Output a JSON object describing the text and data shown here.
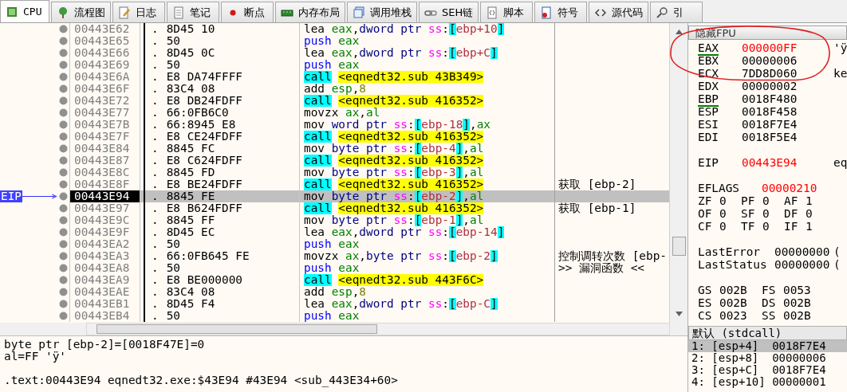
{
  "tabs": [
    {
      "label": "CPU",
      "selected": true
    },
    {
      "label": "流程图",
      "selected": false
    },
    {
      "label": "日志",
      "selected": false
    },
    {
      "label": "笔记",
      "selected": false
    },
    {
      "label": "断点",
      "selected": false
    },
    {
      "label": "内存布局",
      "selected": false
    },
    {
      "label": "调用堆栈",
      "selected": false
    },
    {
      "label": "SEH链",
      "selected": false
    },
    {
      "label": "脚本",
      "selected": false
    },
    {
      "label": "符号",
      "selected": false
    },
    {
      "label": "源代码",
      "selected": false
    },
    {
      "label": "引",
      "selected": false
    }
  ],
  "disassembly": {
    "rows": [
      {
        "address": "00443E62",
        "mark": ".",
        "bytes": "8D45 10",
        "asm": [
          {
            "kind": "mn",
            "text": "lea "
          },
          {
            "kind": "reg",
            "text": "eax"
          },
          {
            "kind": "p",
            "text": ","
          },
          {
            "kind": "sz",
            "text": "dword ptr "
          },
          {
            "kind": "seg",
            "text": "ss"
          },
          {
            "kind": "p",
            "text": ":"
          },
          {
            "kind": "br",
            "text": "["
          },
          {
            "kind": "mem",
            "text": "ebp+10"
          },
          {
            "kind": "br",
            "text": "]"
          }
        ],
        "selected": false
      },
      {
        "address": "00443E65",
        "mark": ".",
        "bytes": "50",
        "asm": [
          {
            "kind": "push",
            "text": "push "
          },
          {
            "kind": "reg",
            "text": "eax"
          }
        ],
        "selected": false
      },
      {
        "address": "00443E66",
        "mark": ".",
        "bytes": "8D45 0C",
        "asm": [
          {
            "kind": "mn",
            "text": "lea "
          },
          {
            "kind": "reg",
            "text": "eax"
          },
          {
            "kind": "p",
            "text": ","
          },
          {
            "kind": "sz",
            "text": "dword ptr "
          },
          {
            "kind": "seg",
            "text": "ss"
          },
          {
            "kind": "p",
            "text": ":"
          },
          {
            "kind": "br",
            "text": "["
          },
          {
            "kind": "mem",
            "text": "ebp+C"
          },
          {
            "kind": "br",
            "text": "]"
          }
        ],
        "selected": false
      },
      {
        "address": "00443E69",
        "mark": ".",
        "bytes": "50",
        "asm": [
          {
            "kind": "push",
            "text": "push "
          },
          {
            "kind": "reg",
            "text": "eax"
          }
        ],
        "selected": false
      },
      {
        "address": "00443E6A",
        "mark": ".",
        "bytes": "E8 DA74FFFF",
        "asm": [
          {
            "kind": "call",
            "text": "call"
          },
          {
            "kind": "tgt",
            "text": "<eqnedt32.sub_43B349>"
          }
        ],
        "selected": false
      },
      {
        "address": "00443E6F",
        "mark": ".",
        "bytes": "83C4 08",
        "asm": [
          {
            "kind": "mn",
            "text": "add "
          },
          {
            "kind": "reg",
            "text": "esp"
          },
          {
            "kind": "p",
            "text": ","
          },
          {
            "kind": "num",
            "text": "8"
          }
        ],
        "selected": false
      },
      {
        "address": "00443E72",
        "mark": ".",
        "bytes": "E8 DB24FDFF",
        "asm": [
          {
            "kind": "call",
            "text": "call"
          },
          {
            "kind": "tgt",
            "text": "<eqnedt32.sub_416352>"
          }
        ],
        "selected": false
      },
      {
        "address": "00443E77",
        "mark": ".",
        "bytes": "66:0FB6C0",
        "asm": [
          {
            "kind": "mn",
            "text": "movzx "
          },
          {
            "kind": "reg",
            "text": "ax"
          },
          {
            "kind": "p",
            "text": ","
          },
          {
            "kind": "reg",
            "text": "al"
          }
        ],
        "selected": false
      },
      {
        "address": "00443E7B",
        "mark": ".",
        "bytes": "66:8945 E8",
        "asm": [
          {
            "kind": "mn",
            "text": "mov "
          },
          {
            "kind": "sz",
            "text": "word ptr "
          },
          {
            "kind": "seg",
            "text": "ss"
          },
          {
            "kind": "p",
            "text": ":"
          },
          {
            "kind": "br",
            "text": "["
          },
          {
            "kind": "mem",
            "text": "ebp-18"
          },
          {
            "kind": "br",
            "text": "]"
          },
          {
            "kind": "p",
            "text": ","
          },
          {
            "kind": "reg",
            "text": "ax"
          }
        ],
        "selected": false
      },
      {
        "address": "00443E7F",
        "mark": ".",
        "bytes": "E8 CE24FDFF",
        "asm": [
          {
            "kind": "call",
            "text": "call"
          },
          {
            "kind": "tgt",
            "text": "<eqnedt32.sub_416352>"
          }
        ],
        "selected": false
      },
      {
        "address": "00443E84",
        "mark": ".",
        "bytes": "8845 FC",
        "asm": [
          {
            "kind": "mn",
            "text": "mov "
          },
          {
            "kind": "sz",
            "text": "byte ptr "
          },
          {
            "kind": "seg",
            "text": "ss"
          },
          {
            "kind": "p",
            "text": ":"
          },
          {
            "kind": "br",
            "text": "["
          },
          {
            "kind": "mem",
            "text": "ebp-4"
          },
          {
            "kind": "br",
            "text": "]"
          },
          {
            "kind": "p",
            "text": ","
          },
          {
            "kind": "reg",
            "text": "al"
          }
        ],
        "selected": false
      },
      {
        "address": "00443E87",
        "mark": ".",
        "bytes": "E8 C624FDFF",
        "asm": [
          {
            "kind": "call",
            "text": "call"
          },
          {
            "kind": "tgt",
            "text": "<eqnedt32.sub_416352>"
          }
        ],
        "selected": false
      },
      {
        "address": "00443E8C",
        "mark": ".",
        "bytes": "8845 FD",
        "asm": [
          {
            "kind": "mn",
            "text": "mov "
          },
          {
            "kind": "sz",
            "text": "byte ptr "
          },
          {
            "kind": "seg",
            "text": "ss"
          },
          {
            "kind": "p",
            "text": ":"
          },
          {
            "kind": "br",
            "text": "["
          },
          {
            "kind": "mem",
            "text": "ebp-3"
          },
          {
            "kind": "br",
            "text": "]"
          },
          {
            "kind": "p",
            "text": ","
          },
          {
            "kind": "reg",
            "text": "al"
          }
        ],
        "selected": false
      },
      {
        "address": "00443E8F",
        "mark": ".",
        "bytes": "E8 BE24FDFF",
        "asm": [
          {
            "kind": "call",
            "text": "call"
          },
          {
            "kind": "tgt",
            "text": "<eqnedt32.sub_416352>"
          }
        ],
        "comment": "获取 [ebp-2]",
        "selected": false
      },
      {
        "address": "00443E94",
        "mark": ".",
        "bytes": "8845 FE",
        "asm": [
          {
            "kind": "mn",
            "text": "mov "
          },
          {
            "kind": "sz",
            "text": "byte ptr "
          },
          {
            "kind": "seg",
            "text": "ss"
          },
          {
            "kind": "p",
            "text": ":"
          },
          {
            "kind": "br",
            "text": "["
          },
          {
            "kind": "mem",
            "text": "ebp-2"
          },
          {
            "kind": "br",
            "text": "]"
          },
          {
            "kind": "p",
            "text": ","
          },
          {
            "kind": "reg",
            "text": "al"
          }
        ],
        "marker": "EIP",
        "selected": true
      },
      {
        "address": "00443E97",
        "mark": ".",
        "bytes": "E8 B624FDFF",
        "asm": [
          {
            "kind": "call",
            "text": "call"
          },
          {
            "kind": "tgt",
            "text": "<eqnedt32.sub_416352>"
          }
        ],
        "comment": "获取 [ebp-1]",
        "selected": false
      },
      {
        "address": "00443E9C",
        "mark": ".",
        "bytes": "8845 FF",
        "asm": [
          {
            "kind": "mn",
            "text": "mov "
          },
          {
            "kind": "sz",
            "text": "byte ptr "
          },
          {
            "kind": "seg",
            "text": "ss"
          },
          {
            "kind": "p",
            "text": ":"
          },
          {
            "kind": "br",
            "text": "["
          },
          {
            "kind": "mem",
            "text": "ebp-1"
          },
          {
            "kind": "br",
            "text": "]"
          },
          {
            "kind": "p",
            "text": ","
          },
          {
            "kind": "reg",
            "text": "al"
          }
        ],
        "selected": false
      },
      {
        "address": "00443E9F",
        "mark": ".",
        "bytes": "8D45 EC",
        "asm": [
          {
            "kind": "mn",
            "text": "lea "
          },
          {
            "kind": "reg",
            "text": "eax"
          },
          {
            "kind": "p",
            "text": ","
          },
          {
            "kind": "sz",
            "text": "dword ptr "
          },
          {
            "kind": "seg",
            "text": "ss"
          },
          {
            "kind": "p",
            "text": ":"
          },
          {
            "kind": "br",
            "text": "["
          },
          {
            "kind": "mem",
            "text": "ebp-14"
          },
          {
            "kind": "br",
            "text": "]"
          }
        ],
        "selected": false
      },
      {
        "address": "00443EA2",
        "mark": ".",
        "bytes": "50",
        "asm": [
          {
            "kind": "push",
            "text": "push "
          },
          {
            "kind": "reg",
            "text": "eax"
          }
        ],
        "selected": false
      },
      {
        "address": "00443EA3",
        "mark": ".",
        "bytes": "66:0FB645 FE",
        "asm": [
          {
            "kind": "mn",
            "text": "movzx "
          },
          {
            "kind": "reg",
            "text": "ax"
          },
          {
            "kind": "p",
            "text": ","
          },
          {
            "kind": "sz",
            "text": "byte ptr "
          },
          {
            "kind": "seg",
            "text": "ss"
          },
          {
            "kind": "p",
            "text": ":"
          },
          {
            "kind": "br",
            "text": "["
          },
          {
            "kind": "mem",
            "text": "ebp-2"
          },
          {
            "kind": "br",
            "text": "]"
          }
        ],
        "comment": "控制调转次数 [ebp-",
        "selected": false
      },
      {
        "address": "00443EA8",
        "mark": ".",
        "bytes": "50",
        "asm": [
          {
            "kind": "push",
            "text": "push "
          },
          {
            "kind": "reg",
            "text": "eax"
          }
        ],
        "comment": ">> 漏洞函数 <<",
        "selected": false
      },
      {
        "address": "00443EA9",
        "mark": ".",
        "bytes": "E8 BE000000",
        "asm": [
          {
            "kind": "call",
            "text": "call"
          },
          {
            "kind": "tgt",
            "text": "<eqnedt32.sub_443F6C>"
          }
        ],
        "selected": false
      },
      {
        "address": "00443EAE",
        "mark": ".",
        "bytes": "83C4 08",
        "asm": [
          {
            "kind": "mn",
            "text": "add "
          },
          {
            "kind": "reg",
            "text": "esp"
          },
          {
            "kind": "p",
            "text": ","
          },
          {
            "kind": "num",
            "text": "8"
          }
        ],
        "selected": false
      },
      {
        "address": "00443EB1",
        "mark": ".",
        "bytes": "8D45 F4",
        "asm": [
          {
            "kind": "mn",
            "text": "lea "
          },
          {
            "kind": "reg",
            "text": "eax"
          },
          {
            "kind": "p",
            "text": ","
          },
          {
            "kind": "sz",
            "text": "dword ptr "
          },
          {
            "kind": "seg",
            "text": "ss"
          },
          {
            "kind": "p",
            "text": ":"
          },
          {
            "kind": "br",
            "text": "["
          },
          {
            "kind": "mem",
            "text": "ebp-C"
          },
          {
            "kind": "br",
            "text": "]"
          }
        ],
        "selected": false
      },
      {
        "address": "00443EB4",
        "mark": ".",
        "bytes": "50",
        "asm": [
          {
            "kind": "push",
            "text": "push "
          },
          {
            "kind": "reg",
            "text": "eax"
          }
        ],
        "selected": false
      }
    ]
  },
  "info": {
    "lines": [
      "byte ptr [ebp-2]=[0018F47E]=0",
      "al=FF 'ÿ'"
    ],
    "location": ".text:00443E94 eqnedt32.exe:$43E94 #43E94 <sub_443E34+60>"
  },
  "registers": {
    "toggle": "隐藏FPU",
    "items": [
      {
        "kind": "reg",
        "name": "EAX",
        "value": "000000FF",
        "changed": true,
        "underlined": true,
        "note": "'ÿ"
      },
      {
        "kind": "reg",
        "name": "EBX",
        "value": "00000006",
        "changed": false,
        "underlined": false
      },
      {
        "kind": "reg",
        "name": "ECX",
        "value": "7DD8D060",
        "changed": false,
        "underlined": false,
        "note": "ke"
      },
      {
        "kind": "reg",
        "name": "EDX",
        "value": "00000002",
        "changed": false,
        "underlined": false
      },
      {
        "kind": "reg",
        "name": "EBP",
        "value": "0018F480",
        "changed": false,
        "underlined": true
      },
      {
        "kind": "reg",
        "name": "ESP",
        "value": "0018F458",
        "changed": false,
        "underlined": false
      },
      {
        "kind": "reg",
        "name": "ESI",
        "value": "0018F7E4",
        "changed": false,
        "underlined": false
      },
      {
        "kind": "reg",
        "name": "EDI",
        "value": "0018F5E4",
        "changed": false,
        "underlined": false
      },
      {
        "kind": "gap"
      },
      {
        "kind": "reg",
        "name": "EIP",
        "value": "00443E94",
        "changed": true,
        "underlined": false,
        "note": "eq"
      },
      {
        "kind": "gap"
      },
      {
        "kind": "wide",
        "name": "EFLAGS",
        "value": "00000210",
        "changed": true,
        "underlined": false
      },
      {
        "kind": "flags",
        "pairs": [
          {
            "name": "ZF",
            "value": "0"
          },
          {
            "name": "PF",
            "value": "0"
          },
          {
            "name": "AF",
            "value": "1"
          }
        ]
      },
      {
        "kind": "flags",
        "pairs": [
          {
            "name": "OF",
            "value": "0"
          },
          {
            "name": "SF",
            "value": "0"
          },
          {
            "name": "DF",
            "value": "0"
          }
        ]
      },
      {
        "kind": "flags",
        "pairs": [
          {
            "name": "CF",
            "value": "0"
          },
          {
            "name": "TF",
            "value": "0"
          },
          {
            "name": "IF",
            "value": "1"
          }
        ]
      },
      {
        "kind": "gap"
      },
      {
        "kind": "status",
        "name": "LastError",
        "value": "00000000",
        "changed": false,
        "underlined": false,
        "note": "("
      },
      {
        "kind": "status",
        "name": "LastStatus",
        "value": "00000000",
        "changed": false,
        "underlined": false,
        "note": "("
      },
      {
        "kind": "gap"
      },
      {
        "kind": "segments",
        "pairs": [
          {
            "name": "GS",
            "value": "002B"
          },
          {
            "name": "FS",
            "value": "0053"
          }
        ]
      },
      {
        "kind": "segments",
        "pairs": [
          {
            "name": "ES",
            "value": "002B"
          },
          {
            "name": "DS",
            "value": "002B"
          }
        ]
      },
      {
        "kind": "segments",
        "pairs": [
          {
            "name": "CS",
            "value": "0023"
          },
          {
            "name": "SS",
            "value": "002B"
          }
        ]
      }
    ]
  },
  "stack": {
    "title": "默认 (stdcall)",
    "rows": [
      {
        "text": "1: [esp+4]  0018F7E4",
        "selected": true
      },
      {
        "text": "2: [esp+8]  00000006",
        "selected": false
      },
      {
        "text": "3: [esp+C]  0018F7E4",
        "selected": false
      },
      {
        "text": "4: [esp+10] 00000001",
        "selected": false
      }
    ]
  }
}
